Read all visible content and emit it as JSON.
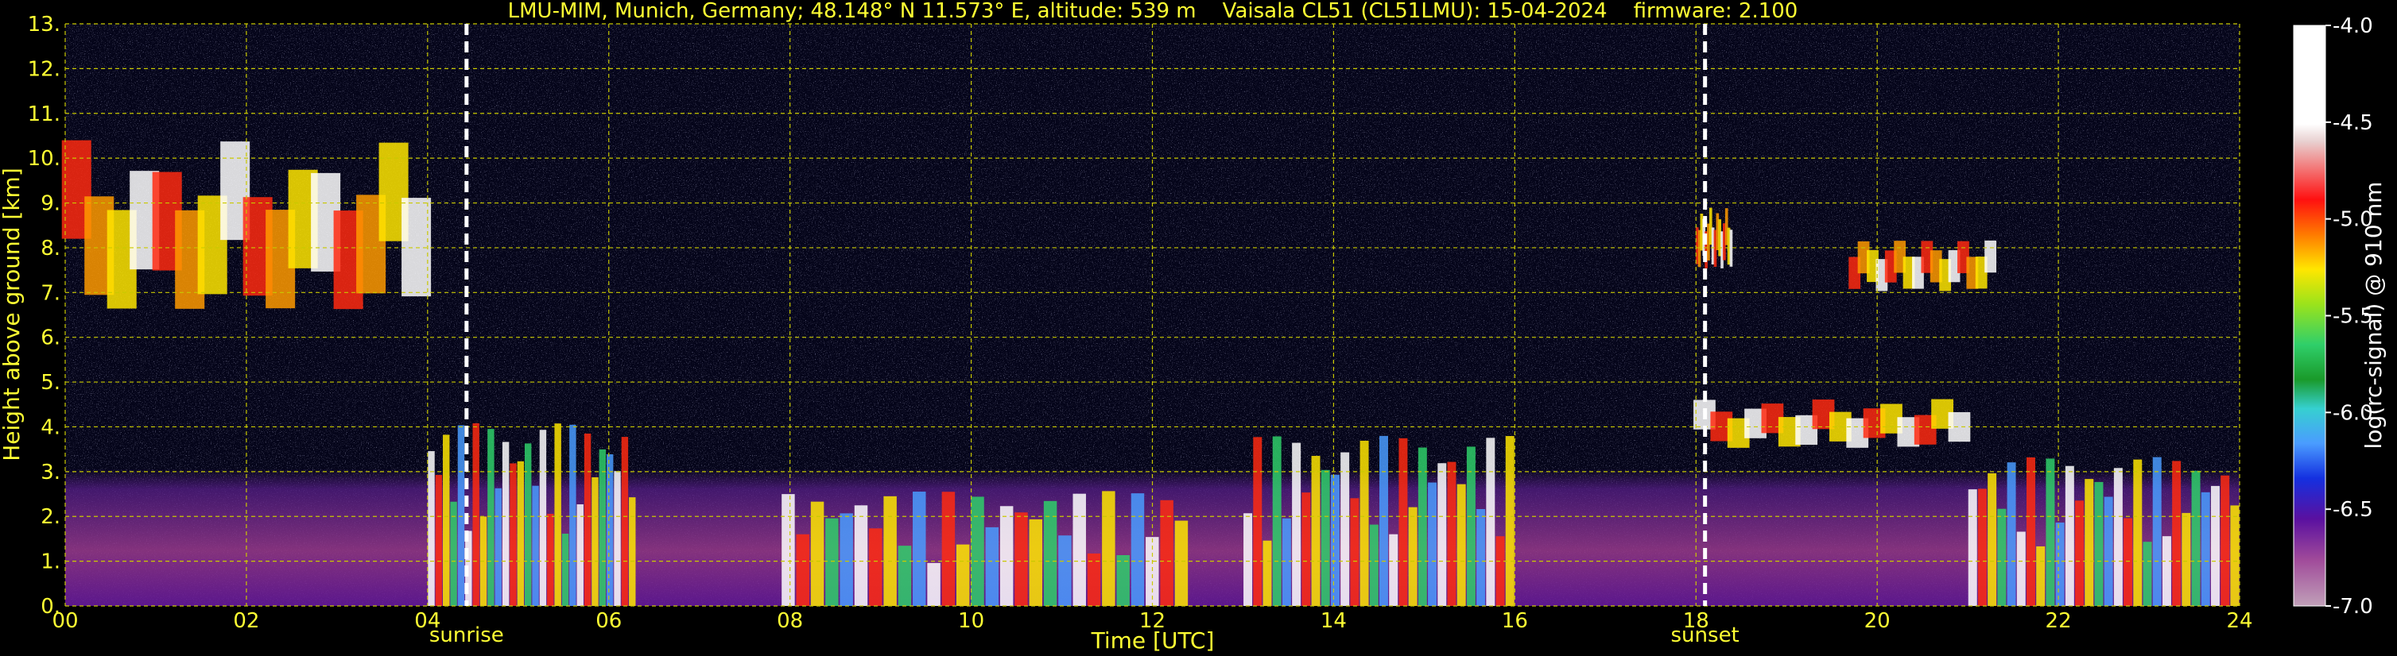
{
  "chart_data": {
    "type": "heatmap",
    "title": "LMU-MIM, Munich, Germany; 48.148° N 11.573° E, altitude: 539 m    Vaisala CL51 (CL51LMU): 15-04-2024    firmware: 2.100",
    "xlabel": "Time [UTC]",
    "ylabel": "Height above ground [km]",
    "x_range": [
      0,
      24
    ],
    "y_range": [
      0,
      13
    ],
    "x_ticks": [
      "00",
      "02",
      "04",
      "06",
      "08",
      "10",
      "12",
      "14",
      "16",
      "18",
      "20",
      "22",
      "24"
    ],
    "x_tick_values": [
      0,
      2,
      4,
      6,
      8,
      10,
      12,
      14,
      16,
      18,
      20,
      22,
      24
    ],
    "y_ticks": [
      "0.",
      "1.",
      "2.",
      "3.",
      "4.",
      "5.",
      "6.",
      "7.",
      "8.",
      "9.",
      "10.",
      "11.",
      "12.",
      "13."
    ],
    "y_tick_values": [
      0,
      1,
      2,
      3,
      4,
      5,
      6,
      7,
      8,
      9,
      10,
      11,
      12,
      13
    ],
    "grid": true,
    "markers": [
      {
        "label": "sunrise",
        "x": 4.43
      },
      {
        "label": "sunset",
        "x": 18.1
      }
    ],
    "colorbar": {
      "label": "log(rc-signal) @ 910 nm",
      "range": [
        -7.0,
        -4.0
      ],
      "ticks": [
        "-4.0",
        "-4.5",
        "-5.0",
        "-5.5",
        "-6.0",
        "-6.5",
        "-7.0"
      ],
      "tick_values": [
        -4.0,
        -4.5,
        -5.0,
        -5.5,
        -6.0,
        -6.5,
        -7.0
      ]
    },
    "features": [
      {
        "kind": "cirrus",
        "x": [
          0.0,
          4.0
        ],
        "y": [
          6.5,
          10.5
        ]
      },
      {
        "kind": "cirrus",
        "x": [
          18.0,
          18.4
        ],
        "y": [
          7.5,
          9.0
        ]
      },
      {
        "kind": "cirrus",
        "x": [
          19.7,
          21.3
        ],
        "y": [
          7.0,
          8.3
        ]
      },
      {
        "kind": "cloud_layer",
        "x": [
          18.0,
          21.0
        ],
        "y": [
          3.5,
          4.7
        ]
      },
      {
        "kind": "low_clouds",
        "x": [
          4.0,
          6.3
        ],
        "y": [
          0.0,
          4.3
        ]
      },
      {
        "kind": "low_clouds",
        "x": [
          7.9,
          12.4
        ],
        "y": [
          0.0,
          2.7
        ]
      },
      {
        "kind": "low_clouds",
        "x": [
          13.0,
          16.0
        ],
        "y": [
          0.0,
          4.0
        ]
      },
      {
        "kind": "low_clouds",
        "x": [
          21.0,
          24.0
        ],
        "y": [
          0.0,
          3.5
        ]
      },
      {
        "kind": "boundary_layer",
        "x": [
          0.0,
          24.0
        ],
        "y": [
          0.0,
          2.0
        ]
      }
    ]
  }
}
